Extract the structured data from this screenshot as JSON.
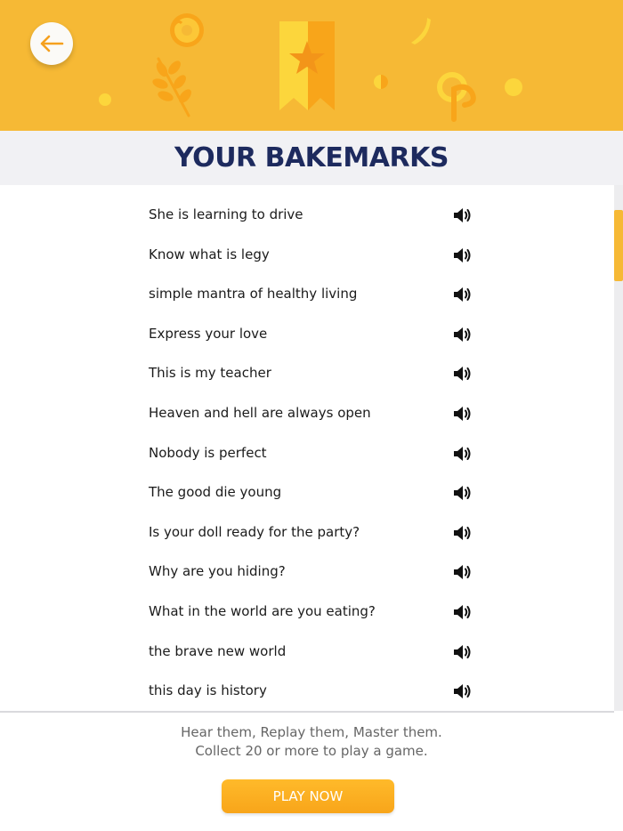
{
  "header": {
    "title": "YOUR BAKEMARKS",
    "colors": {
      "banner": "#F6B935",
      "title": "#1D2A5E",
      "accent": "#F8A51A"
    },
    "back_icon": "arrow-left-icon",
    "decorations": [
      "donut-icon",
      "wheat-icon",
      "bookmark-star-icon",
      "pretzel-icon",
      "crumb-icon"
    ]
  },
  "bakemarks": [
    {
      "text": "She is learning to drive",
      "icon": "speaker-icon"
    },
    {
      "text": "Know what is legy",
      "icon": "speaker-icon"
    },
    {
      "text": "simple mantra of healthy living",
      "icon": "speaker-icon"
    },
    {
      "text": "Express your love",
      "icon": "speaker-icon"
    },
    {
      "text": "This is my teacher",
      "icon": "speaker-icon"
    },
    {
      "text": "Heaven and hell are always open",
      "icon": "speaker-icon"
    },
    {
      "text": "Nobody is perfect",
      "icon": "speaker-icon"
    },
    {
      "text": "The good die young",
      "icon": "speaker-icon"
    },
    {
      "text": "Is your doll ready for the party?",
      "icon": "speaker-icon"
    },
    {
      "text": "Why are you hiding?",
      "icon": "speaker-icon"
    },
    {
      "text": "What in the world are you eating?",
      "icon": "speaker-icon"
    },
    {
      "text": "the brave new world",
      "icon": "speaker-icon"
    },
    {
      "text": "this day is history",
      "icon": "speaker-icon"
    }
  ],
  "footer": {
    "line1": "Hear them, Replay them, Master them.",
    "line2": "Collect 20 or more to play a game.",
    "play_label": "PLAY NOW"
  }
}
